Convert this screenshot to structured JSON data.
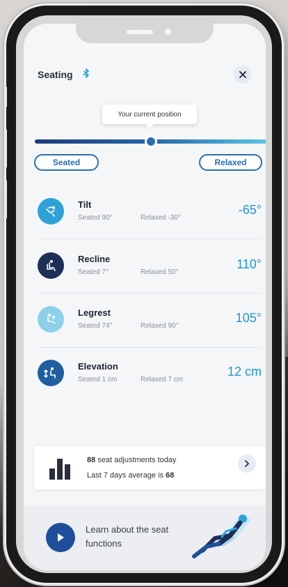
{
  "header": {
    "title": "Seating",
    "bluetooth_icon": "bluetooth-icon",
    "close_icon": "close-icon"
  },
  "position": {
    "tooltip": "Your current position",
    "slider_value": 0.5,
    "seated_label": "Seated",
    "relaxed_label": "Relaxed"
  },
  "functions": [
    {
      "name": "Tilt",
      "seated": "Seated 90°",
      "relaxed": "Relaxed -30°",
      "value": "-65°",
      "icon": "tilt-icon",
      "color": "#2ea2d8"
    },
    {
      "name": "Recline",
      "seated": "Seated 7°",
      "relaxed": "Relaxed 50°",
      "value": "110°",
      "icon": "recline-icon",
      "color": "#1d2f56"
    },
    {
      "name": "Legrest",
      "seated": "Seated 74°",
      "relaxed": "Relaxed 90°",
      "value": "105°",
      "icon": "legrest-icon",
      "color": "#8ed0ea"
    },
    {
      "name": "Elevation",
      "seated": "Seated 1 cm",
      "relaxed": "Relaxed 7 cm",
      "value": "12 cm",
      "icon": "elevation-icon",
      "color": "#1f5fa0"
    }
  ],
  "stats": {
    "count": "88",
    "count_suffix": " seat adjustments today",
    "avg_prefix": "Last 7 days average is ",
    "avg": "68"
  },
  "learn": {
    "text": "Learn about the seat functions"
  },
  "colors": {
    "accent": "#1f95d4",
    "brand": "#2a6eb3",
    "dark": "#1d2433"
  }
}
